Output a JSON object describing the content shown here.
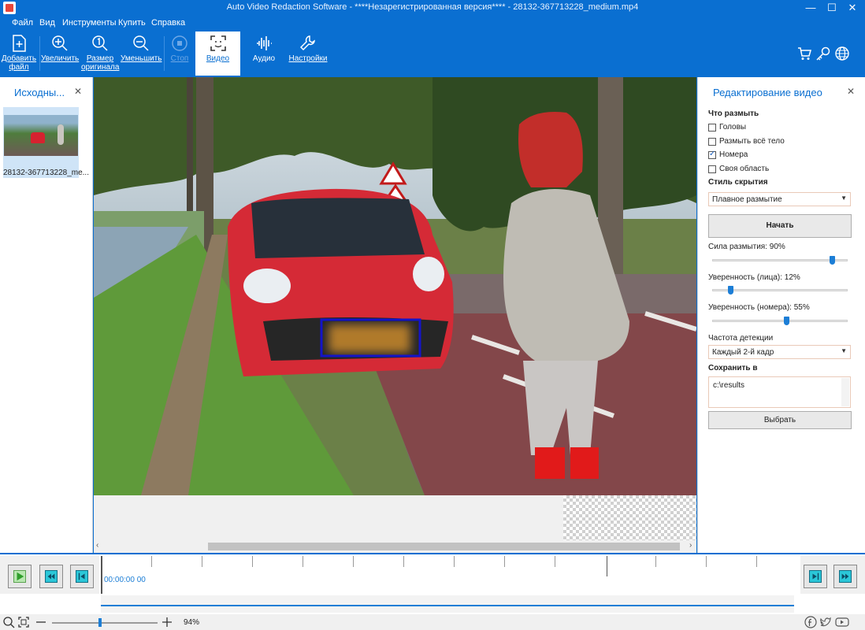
{
  "window": {
    "title": "Auto Video Redaction Software - ****Незарегистрированная версия**** - 28132-367713228_medium.mp4",
    "controls": [
      "—",
      "☐",
      "✕"
    ]
  },
  "menu": [
    "Файл",
    "Вид",
    "Инструменты",
    "Купить",
    "Справка"
  ],
  "toolbar": {
    "add_file": [
      "Добавить",
      "файл"
    ],
    "zoom_in": "Увеличить",
    "original_size": [
      "Размер",
      "оригинала"
    ],
    "zoom_out": "Уменьшить",
    "stop": "Стоп",
    "tabs": {
      "video": "Видео",
      "audio": "Аудио",
      "settings": "Настройки"
    },
    "right_icons": [
      "cart-icon",
      "key-icon",
      "globe-icon"
    ]
  },
  "sources": {
    "title": "Исходны...",
    "close": "✕",
    "items": [
      {
        "name": "28132-367713228_me..."
      }
    ]
  },
  "edit_panel": {
    "title": "Редактирование видео",
    "close": "✕",
    "what_blur_label": "Что размыть",
    "options": [
      {
        "label": "Головы",
        "checked": false
      },
      {
        "label": "Размыть всё тело",
        "checked": false
      },
      {
        "label": "Номера",
        "checked": true
      },
      {
        "label": "Своя область",
        "checked": false
      }
    ],
    "hide_style_label": "Стиль скрытия",
    "hide_style_value": "Плавное размытие",
    "start_button": "Начать",
    "blur_strength_label": "Сила размытия: 90%",
    "blur_strength": 0.9,
    "confidence_face_label": "Уверенность (лица): 12%",
    "confidence_face": 0.12,
    "confidence_plate_label": "Уверенность (номера): 55%",
    "confidence_plate": 0.55,
    "detection_freq_label": "Частота детекции",
    "detection_freq_value": "Каждый 2-й кадр",
    "save_to_label": "Сохранить в",
    "save_path": "c:\\results",
    "choose_button": "Выбрать"
  },
  "timeline": {
    "time": "00:00:00 00",
    "zoom_percent": "94%"
  },
  "colors": {
    "accent": "#0a6fd1",
    "highlight": "#1c7ed6",
    "detection_box": "#1414c8"
  }
}
